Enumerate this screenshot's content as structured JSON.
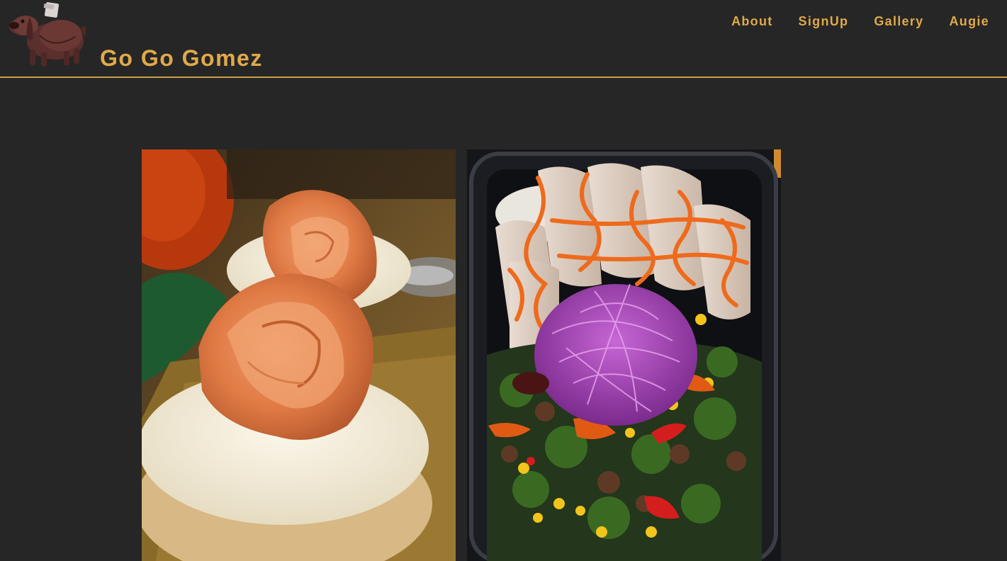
{
  "site": {
    "title": "Go Go Gomez",
    "logo_icon": "dog-logo-icon"
  },
  "nav": {
    "items": [
      {
        "label": "About"
      },
      {
        "label": "SignUp"
      },
      {
        "label": "Gallery"
      },
      {
        "label": "Augie"
      }
    ]
  },
  "colors": {
    "background": "#262626",
    "accent": "#e0a94a",
    "divider": "#c9a04a"
  },
  "gallery": {
    "photos": [
      {
        "subject": "smoked-salmon-roses-on-cream-cheese-biscuits"
      },
      {
        "subject": "chicken-rice-cabbage-vegetable-meal-prep-container"
      }
    ]
  }
}
